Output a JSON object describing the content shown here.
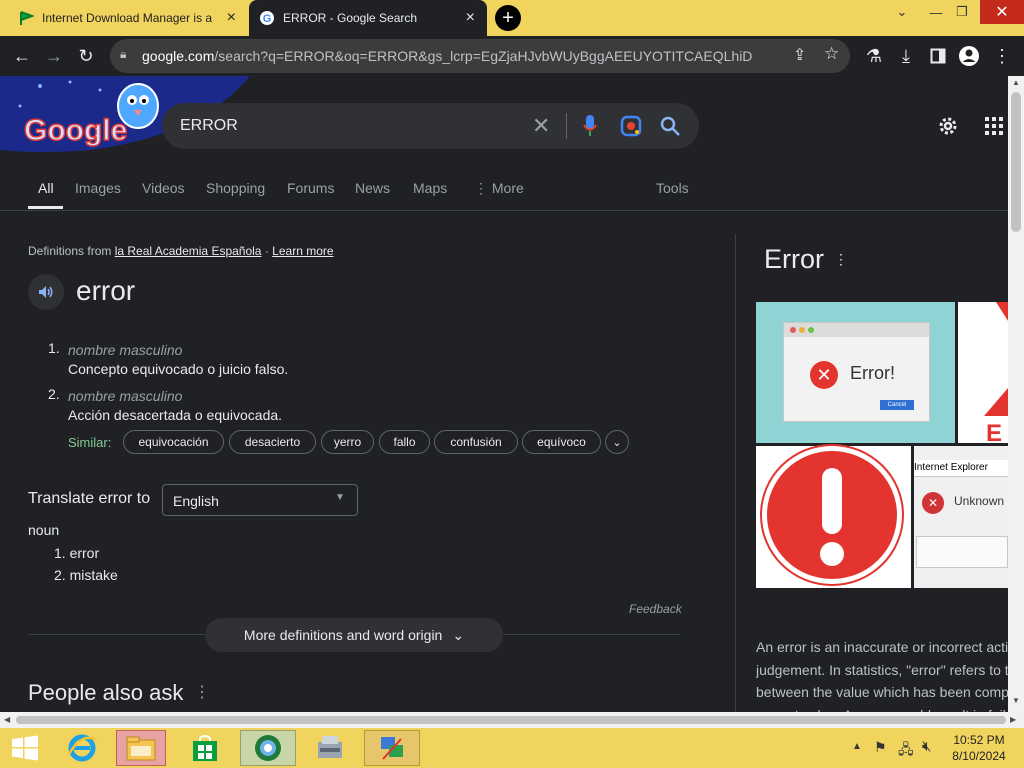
{
  "tabs": [
    {
      "title": "Internet Download Manager is a"
    },
    {
      "title": "ERROR - Google Search"
    }
  ],
  "address": {
    "domain": "google.com",
    "path": "/search?q=ERROR&oq=ERROR&gs_lcrp=EgZjaHJvbWUyBggAEEUYOTITCAEQLhiDARjHARi..."
  },
  "search": {
    "query": "ERROR"
  },
  "nav": [
    "All",
    "Images",
    "Videos",
    "Shopping",
    "Forums",
    "News",
    "Maps",
    "More",
    "Tools"
  ],
  "dictionary": {
    "source_prefix": "Definitions from",
    "source_link": "la Real Academia Española",
    "separator": "·",
    "learn_more": "Learn more",
    "word": "error",
    "definitions": [
      {
        "num": "1.",
        "pos": "nombre masculino",
        "text": "Concepto equivocado o juicio falso."
      },
      {
        "num": "2.",
        "pos": "nombre masculino",
        "text": "Acción desacertada o equivocada."
      }
    ],
    "similar_label": "Similar:",
    "similar": [
      "equivocación",
      "desacierto",
      "yerro",
      "fallo",
      "confusión",
      "equívoco"
    ]
  },
  "translate": {
    "label": "Translate error to",
    "language": "English",
    "pos": "noun",
    "items": [
      "1. error",
      "2. mistake"
    ]
  },
  "feedback": "Feedback",
  "more_definitions": "More definitions and word origin",
  "people_also_ask": "People also ask",
  "knowledge_panel": {
    "title": "Error",
    "img_dialog_text": "Error!",
    "img_dialog_button": "Cancel",
    "img_ie_title": "Internet Explorer",
    "img_ie_text": "Unknown",
    "img_letter": "E",
    "desc_lines": [
      "An error is an inaccurate or incorrect acti",
      "judgement. In statistics, \"error\" refers to t",
      "between the value which has been comp",
      "correct value. An error could result in fail"
    ]
  },
  "clock": {
    "time": "10:52 PM",
    "date": "8/10/2024"
  },
  "colors": {
    "titlebar": "#f0d45e",
    "page_bg": "#202124",
    "accent_blue": "#8ab4f8",
    "similar_green": "#81c995",
    "error_red": "#e3342f"
  }
}
